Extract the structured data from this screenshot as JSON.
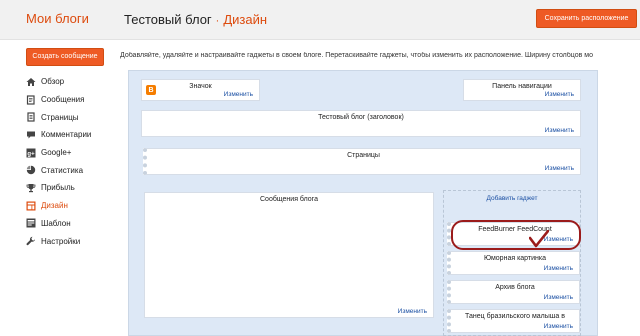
{
  "header": {
    "brand": "Мои блоги",
    "blog_title": "Тестовый блог",
    "separator": "·",
    "section": "Дизайн",
    "save_label": "Сохранить расположение"
  },
  "sidebar": {
    "new_post_label": "Создать сообщение",
    "items": [
      {
        "label": "Обзор",
        "icon": "home-icon"
      },
      {
        "label": "Сообщения",
        "icon": "posts-icon"
      },
      {
        "label": "Страницы",
        "icon": "pages-icon"
      },
      {
        "label": "Комментарии",
        "icon": "comments-icon"
      },
      {
        "label": "Google+",
        "icon": "google-plus-icon"
      },
      {
        "label": "Статистика",
        "icon": "stats-icon"
      },
      {
        "label": "Прибыль",
        "icon": "trophy-icon"
      },
      {
        "label": "Дизайн",
        "icon": "layout-icon",
        "active": true
      },
      {
        "label": "Шаблон",
        "icon": "template-icon"
      },
      {
        "label": "Настройки",
        "icon": "wrench-icon"
      }
    ]
  },
  "description": "Добавляйте, удаляйте и настраивайте гаджеты в своем блоге. Перетаскивайте гаджеты, чтобы изменить их расположение. Ширину столбцов мо",
  "layout": {
    "edit_label": "Изменить",
    "favicon": {
      "title": "Значок",
      "icon_letter": "B"
    },
    "navbar": {
      "title": "Панель навигации"
    },
    "header": {
      "title": "Тестовый блог (заголовок)"
    },
    "pages": {
      "title": "Страницы"
    },
    "main": {
      "title": "Сообщения блога"
    },
    "add_gadget": "Добавить гаджет",
    "sidebar_gadgets": [
      {
        "title": "FeedBurner FeedCount"
      },
      {
        "title": "Юморная картинка"
      },
      {
        "title": "Архив блога"
      },
      {
        "title": "Танец бразильского малыша в"
      }
    ]
  },
  "colors": {
    "accent": "#dd4b0e",
    "button": "#ee5a24",
    "link": "#1a4fa3",
    "highlight": "#9b1b1b",
    "canvas": "#dde8f6"
  }
}
